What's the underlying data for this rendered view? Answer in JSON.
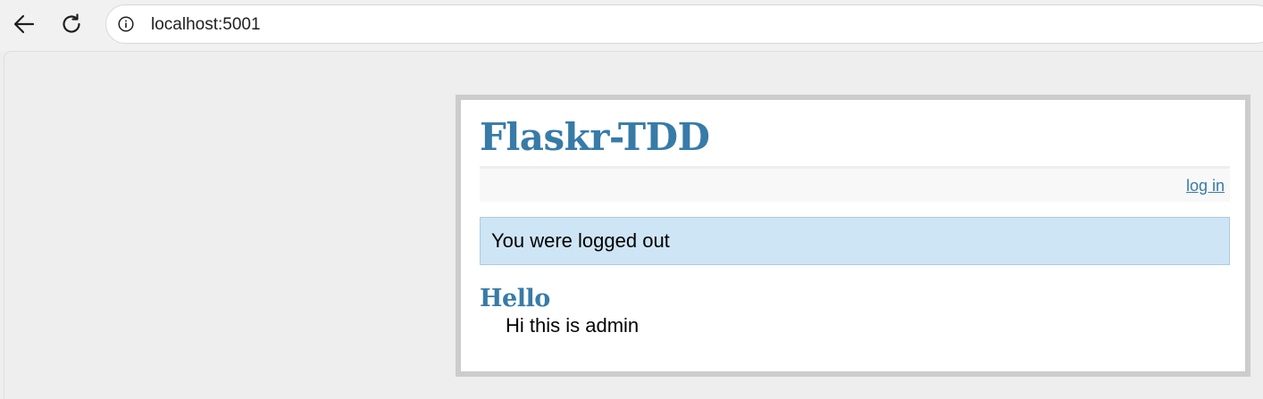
{
  "browser": {
    "url": "localhost:5001",
    "back_icon": "arrow-left-icon",
    "reload_icon": "reload-icon",
    "info_icon": "info-circle-icon"
  },
  "page": {
    "title": "Flaskr-TDD",
    "nav": {
      "login_label": "log in"
    },
    "flash_message": "You were logged out",
    "entries": [
      {
        "title": "Hello",
        "text": "Hi this is admin"
      }
    ]
  },
  "colors": {
    "title": "#377ba8",
    "link": "#377ba8",
    "flash_background": "#cee5f5",
    "flash_border": "#aacbe2",
    "page_border": "#cccccc",
    "background": "#eeeeee"
  }
}
